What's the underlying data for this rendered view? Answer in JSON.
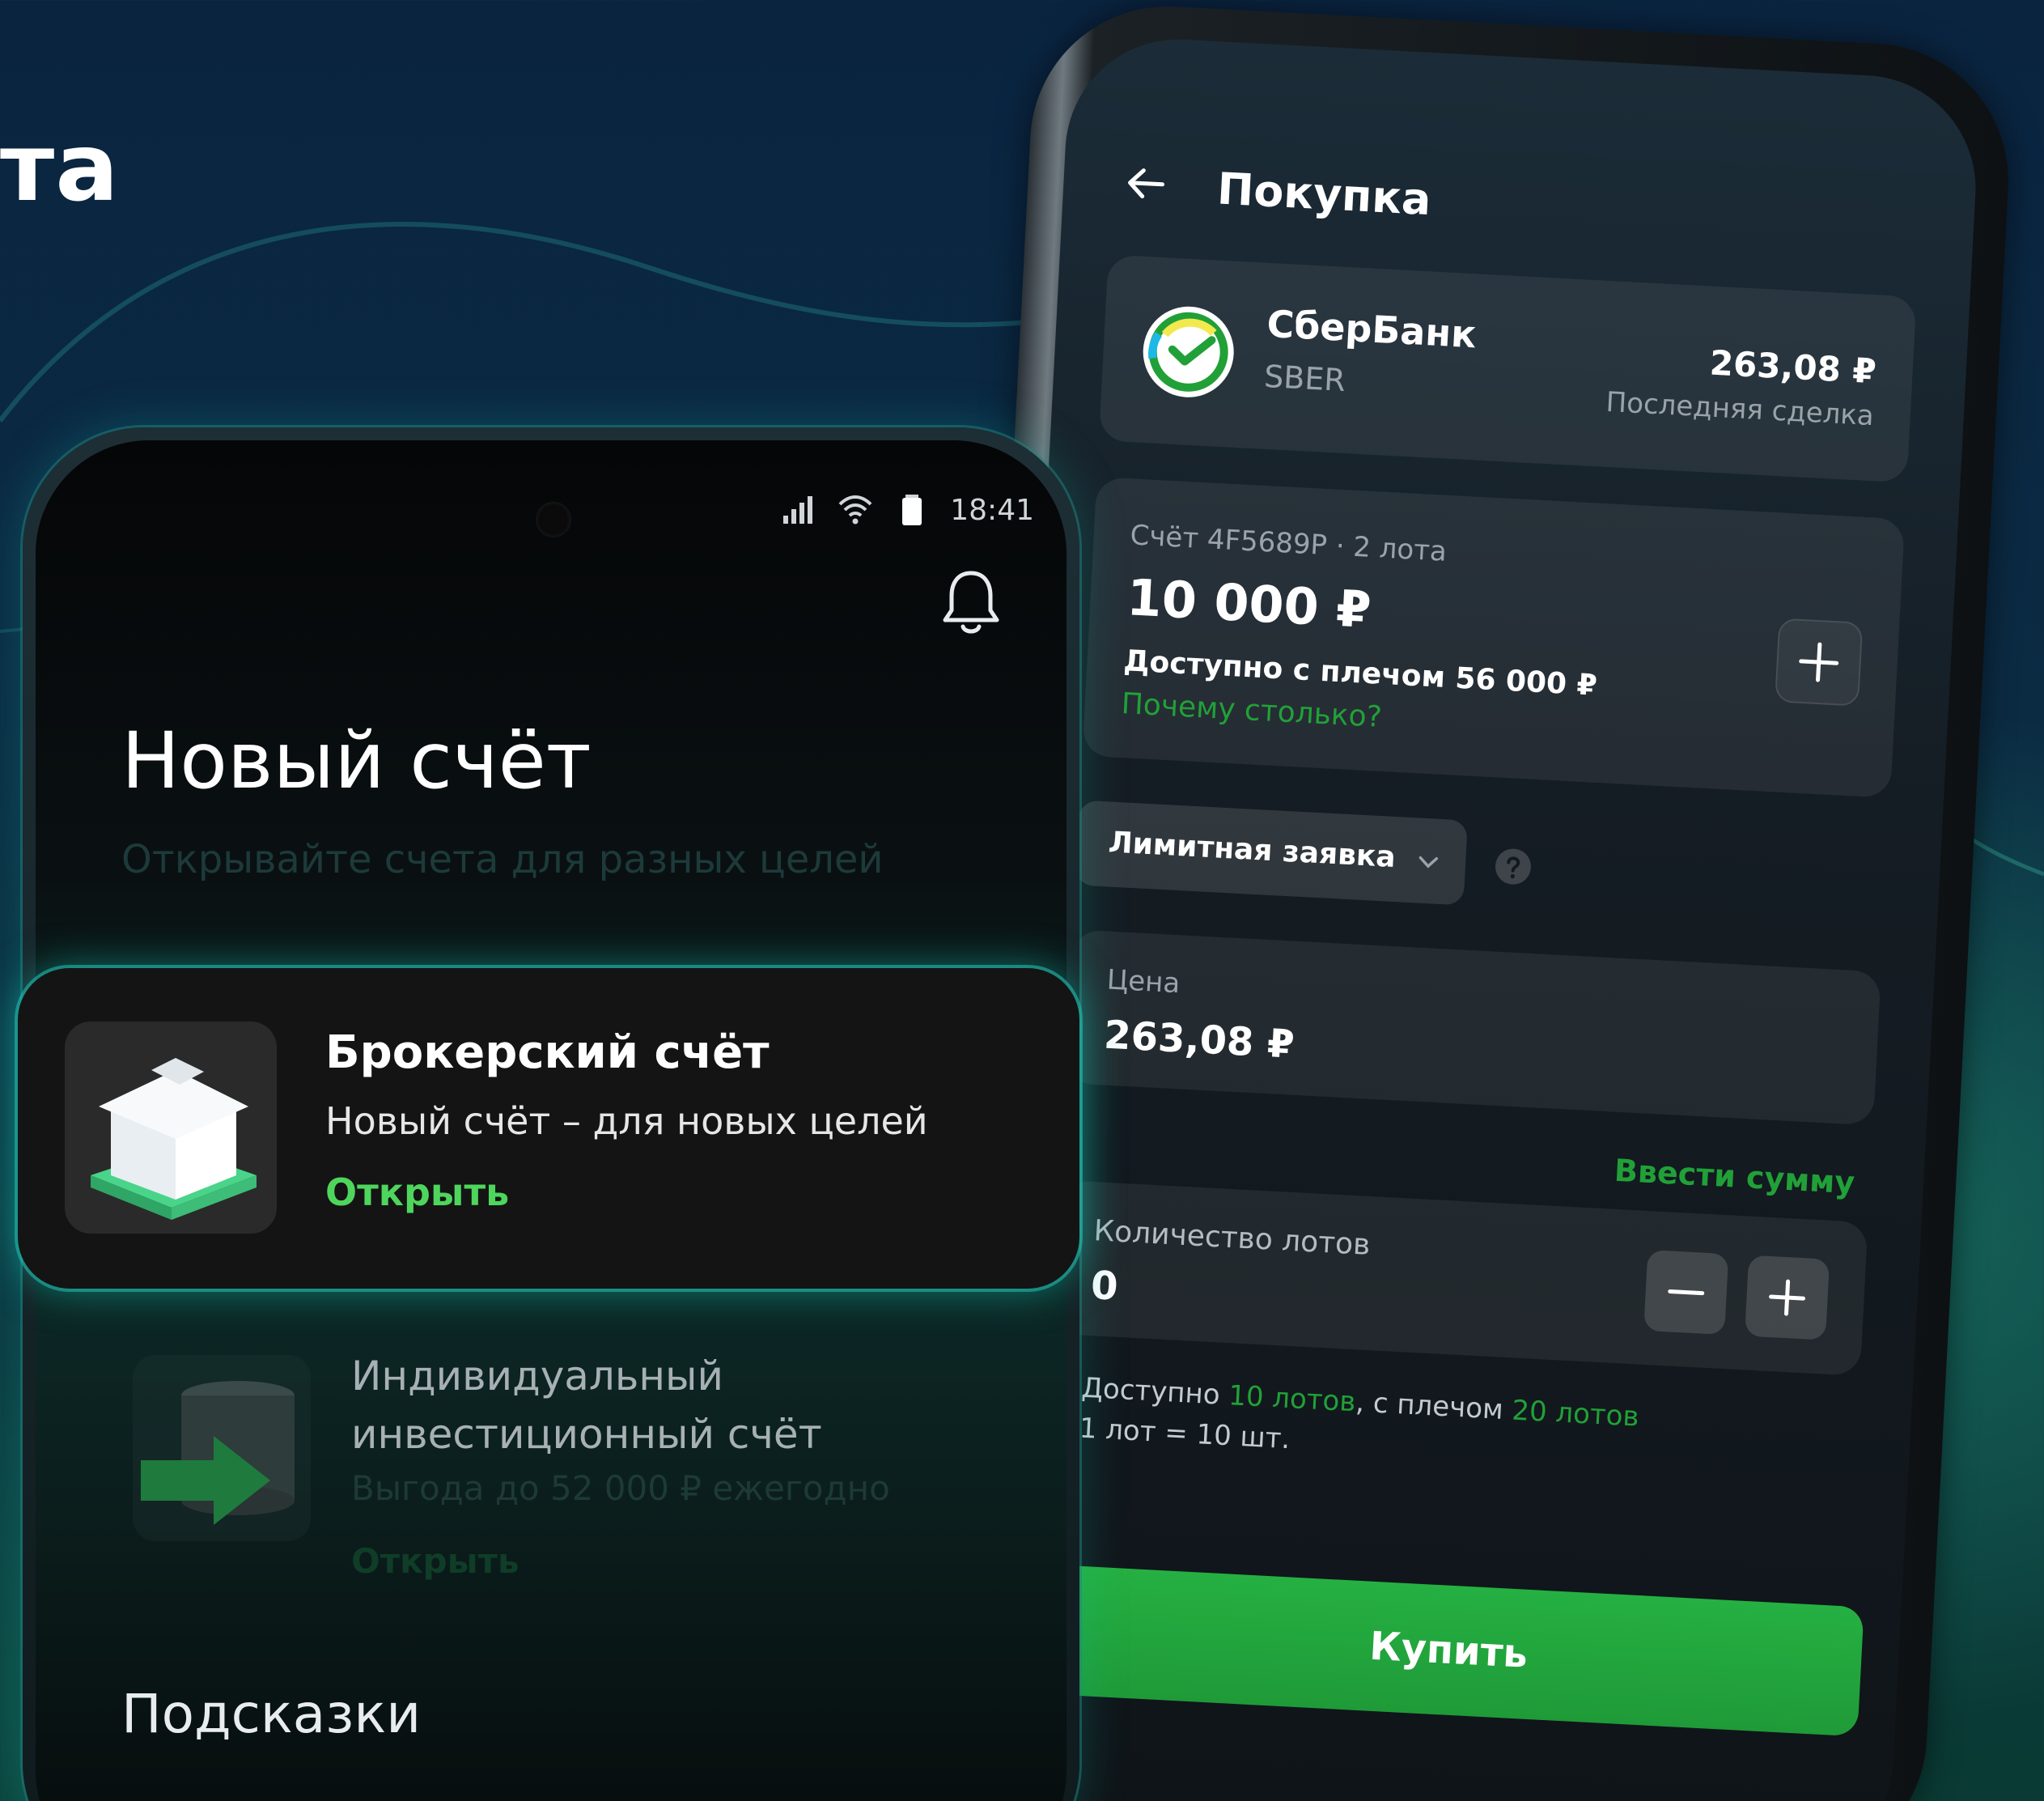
{
  "background": {
    "headline_fragment": "та"
  },
  "purchase_screen": {
    "title": "Покупка",
    "stock": {
      "name": "СберБанк",
      "ticker": "SBER",
      "price": "263,08 ₽",
      "price_label": "Последняя сделка"
    },
    "account": {
      "label": "Счёт 4F5689P · 2 лота",
      "amount": "10 000 ₽",
      "available_with_leverage": "Доступно с плечом 56 000 ₽",
      "why_link": "Почему столько?"
    },
    "order_type": {
      "selected": "Лимитная заявка"
    },
    "price_field": {
      "label": "Цена",
      "value": "263,08 ₽"
    },
    "enter_amount_link": "Ввести сумму",
    "lots_field": {
      "label": "Количество лотов",
      "value": "0"
    },
    "availability": {
      "prefix": "Доступно ",
      "lots": "10 лотов",
      "middle": ", с плечом ",
      "leverage_lots": "20 лотов",
      "lot_size": "1 лот = 10 шт."
    },
    "buy_button": "Купить"
  },
  "new_account_screen": {
    "status_time": "18:41",
    "title": "Новый счёт",
    "subtitle": "Открывайте счета для разных целей",
    "broker_card": {
      "title": "Брокерский счёт",
      "description": "Новый счёт – для новых целей",
      "action": "Открыть"
    },
    "iis_item": {
      "title_line1": "Индивидуальный",
      "title_line2": "инвестиционный счёт",
      "benefit": "Выгода до 52 000 ₽ ежегодно",
      "action": "Открыть"
    },
    "hints_title": "Подсказки"
  },
  "colors": {
    "accent_green": "#21a038",
    "bright_green": "#4ed65c",
    "glow_teal": "#14c8b4"
  }
}
